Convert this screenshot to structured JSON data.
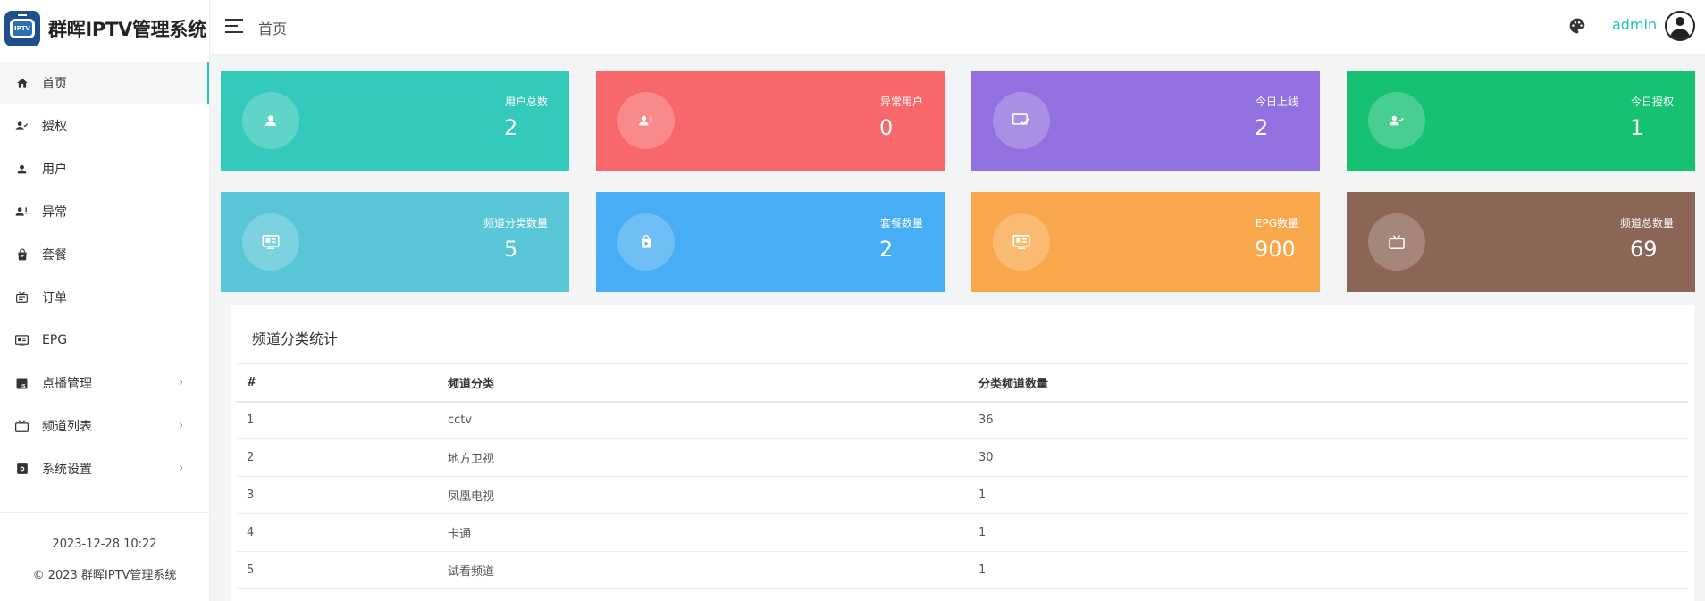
{
  "brand": {
    "title": "群晖IPTV管理系统",
    "logo_text": "IPTV"
  },
  "sidebar": {
    "items": [
      {
        "label": "首页",
        "icon": "home-icon",
        "active": true
      },
      {
        "label": "授权",
        "icon": "user-check-icon"
      },
      {
        "label": "用户",
        "icon": "user-icon"
      },
      {
        "label": "异常",
        "icon": "user-alert-icon"
      },
      {
        "label": "套餐",
        "icon": "shopping-bag-icon"
      },
      {
        "label": "订单",
        "icon": "tv-order-icon"
      },
      {
        "label": "EPG",
        "icon": "guide-icon"
      },
      {
        "label": "点播管理",
        "icon": "js-file-icon",
        "arrow": "›"
      },
      {
        "label": "频道列表",
        "icon": "tv-icon",
        "arrow": "›"
      },
      {
        "label": "系统设置",
        "icon": "settings-icon",
        "arrow": "›"
      }
    ],
    "footer_datetime": "2023-12-28 10:22",
    "footer_copyright": "© 2023 群晖IPTV管理系统"
  },
  "header": {
    "breadcrumb": "首页",
    "user": "admin"
  },
  "stats": [
    {
      "label": "用户总数",
      "value": "2",
      "color": "#33c9bb",
      "icon": "user-icon"
    },
    {
      "label": "异常用户",
      "value": "0",
      "color": "#f8686b",
      "icon": "user-alert-icon"
    },
    {
      "label": "今日上线",
      "value": "2",
      "color": "#9370df",
      "icon": "online-icon"
    },
    {
      "label": "今日授权",
      "value": "1",
      "color": "#16c172",
      "icon": "user-check-icon"
    },
    {
      "label": "频道分类数量",
      "value": "5",
      "color": "#58c6d7",
      "icon": "guide-icon"
    },
    {
      "label": "套餐数量",
      "value": "2",
      "color": "#47adf4",
      "icon": "shopping-bag-icon"
    },
    {
      "label": "EPG数量",
      "value": "900",
      "color": "#f9a74b",
      "icon": "guide-icon"
    },
    {
      "label": "频道总数量",
      "value": "69",
      "color": "#8b6556",
      "icon": "tv-icon"
    }
  ],
  "panel": {
    "title": "频道分类统计",
    "columns": [
      "#",
      "频道分类",
      "分类频道数量"
    ],
    "rows": [
      [
        "1",
        "cctv",
        "36"
      ],
      [
        "2",
        "地方卫视",
        "30"
      ],
      [
        "3",
        "凤凰电视",
        "1"
      ],
      [
        "4",
        "卡通",
        "1"
      ],
      [
        "5",
        "试看频道",
        "1"
      ]
    ]
  }
}
